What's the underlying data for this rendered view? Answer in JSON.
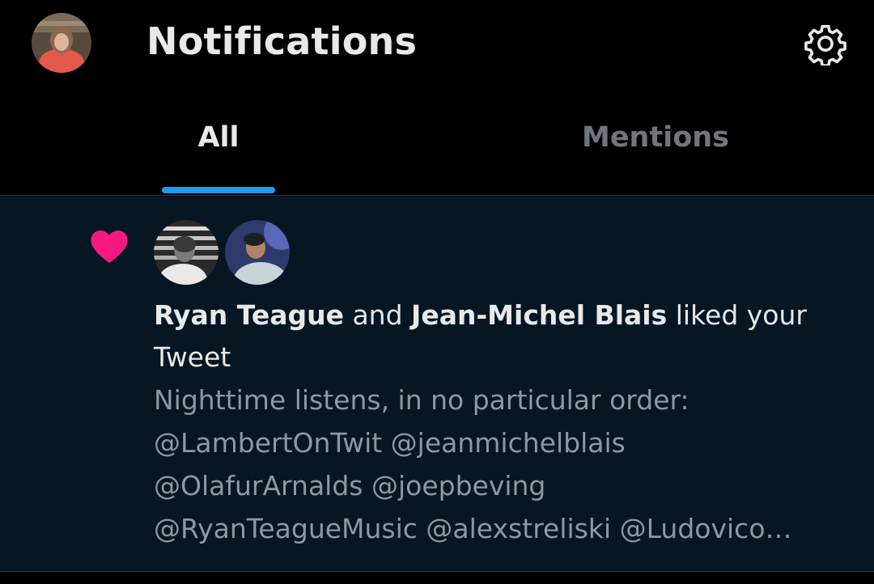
{
  "header": {
    "title": "Notifications",
    "avatar_icon": "user-avatar",
    "settings_icon": "gear-icon"
  },
  "tabs": [
    {
      "label": "All",
      "active": true
    },
    {
      "label": "Mentions",
      "active": false
    }
  ],
  "notification": {
    "type": "like",
    "icon": "heart-icon",
    "icon_color": "#f91880",
    "user1": "Ryan Teague",
    "connector": " and ",
    "user2": "Jean-Michel Blais",
    "action": " liked your Tweet",
    "tweet_lines": [
      "Nighttime listens, in no particular order:",
      "@LambertOnTwit @jeanmichelblais",
      "@OlafurArnalds @joepbeving",
      "@RyanTeagueMusic @alexstreliski @Ludovico…"
    ]
  },
  "colors": {
    "accent": "#1d9bf0",
    "background": "#000000",
    "notification_bg": "#061622",
    "text_primary": "#e7e9ea",
    "text_secondary": "#8b98a5"
  }
}
